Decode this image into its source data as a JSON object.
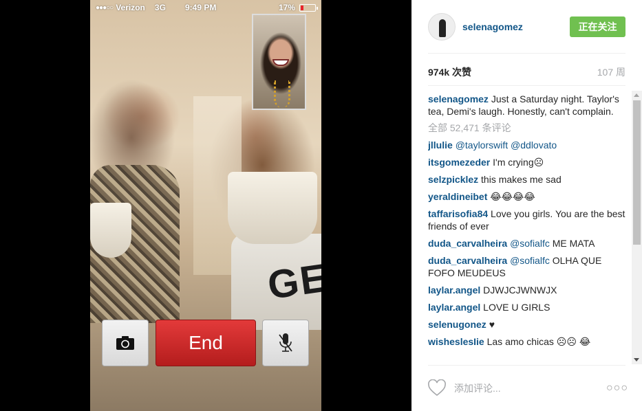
{
  "video": {
    "status_bar": {
      "carrier": "Verizon",
      "network": "3G",
      "time": "9:49 PM",
      "battery": "17%",
      "battery_level": 0.17,
      "battery_color": "#e8242b"
    },
    "shirt_text": "GEI",
    "controls": {
      "flip_icon": "camera-flip-icon",
      "end_label": "End",
      "mute_icon": "mute-microphone-icon"
    }
  },
  "post": {
    "username": "selenagomez",
    "follow_label": "正在关注",
    "follow_color": "#70c050",
    "likes": "974k 次赞",
    "age": "107 周",
    "caption": {
      "user": "selenagomez",
      "text": "Just a Saturday night. Taylor's tea, Demi's laugh. Honestly, can't complain."
    },
    "all_comments": "全部 52,471 条评论",
    "comments": [
      {
        "user": "jllulie",
        "mention1": "@taylorswift",
        "mention2": "@ddlovato",
        "text": ""
      },
      {
        "user": "itsgomezeder",
        "text": "I'm crying☹"
      },
      {
        "user": "selzpicklez",
        "text": "this makes me sad"
      },
      {
        "user": "yeraldineibet",
        "text": "😂😂😂😂"
      },
      {
        "user": "taffarisofia84",
        "text": "Love you girls. You are the best friends of ever"
      },
      {
        "user": "duda_carvalheira",
        "mention1": "@sofialfc",
        "text": "ME MATA"
      },
      {
        "user": "duda_carvalheira",
        "mention1": "@sofialfc",
        "text": "OLHA QUE FOFO MEUDEUS"
      },
      {
        "user": "laylar.angel",
        "text": "DJWJCJWNWJX"
      },
      {
        "user": "laylar.angel",
        "text": "LOVE U GIRLS"
      },
      {
        "user": "selenugonez",
        "text": "♥"
      },
      {
        "user": "wisheslesIie",
        "text": "Las amo chicas ☹☹ 😂"
      }
    ],
    "add_comment_placeholder": "添加评论...",
    "more_label": "…",
    "icons": {
      "like": "heart-icon",
      "more": "more-options-icon"
    }
  }
}
